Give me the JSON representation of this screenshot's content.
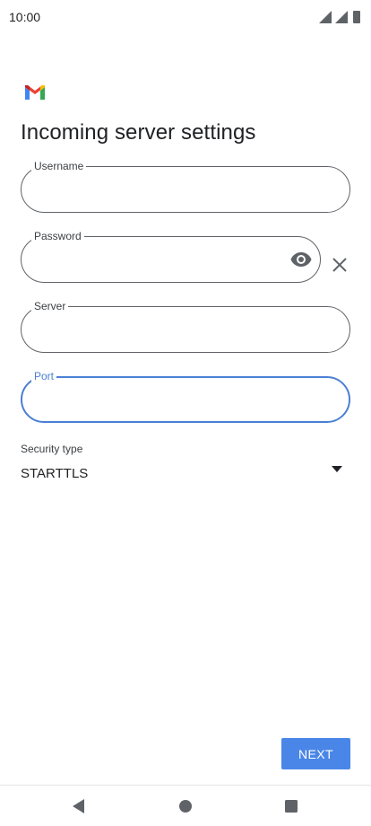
{
  "status_bar": {
    "time": "10:00",
    "icons": [
      "signal-icon",
      "signal-icon",
      "battery-icon"
    ]
  },
  "app": {
    "logo_icon": "gmail-logo-icon"
  },
  "page": {
    "title": "Incoming server settings"
  },
  "form": {
    "username": {
      "label": "Username",
      "value": ""
    },
    "password": {
      "label": "Password",
      "value": "",
      "visibility_icon": "eye-icon",
      "clear_icon": "close-icon"
    },
    "server": {
      "label": "Server",
      "value": ""
    },
    "port": {
      "label": "Port",
      "value": "",
      "focused": true
    }
  },
  "security": {
    "label": "Security type",
    "selected": "STARTTLS",
    "dropdown_icon": "dropdown-arrow-icon"
  },
  "actions": {
    "next_label": "NEXT"
  },
  "navigation": {
    "back_icon": "back-triangle-icon",
    "home_icon": "home-circle-icon",
    "recents_icon": "recents-square-icon"
  },
  "colors": {
    "accent": "#4a86e8",
    "focus": "#4a7fd4",
    "outline": "#5f6368",
    "text": "#202124"
  }
}
